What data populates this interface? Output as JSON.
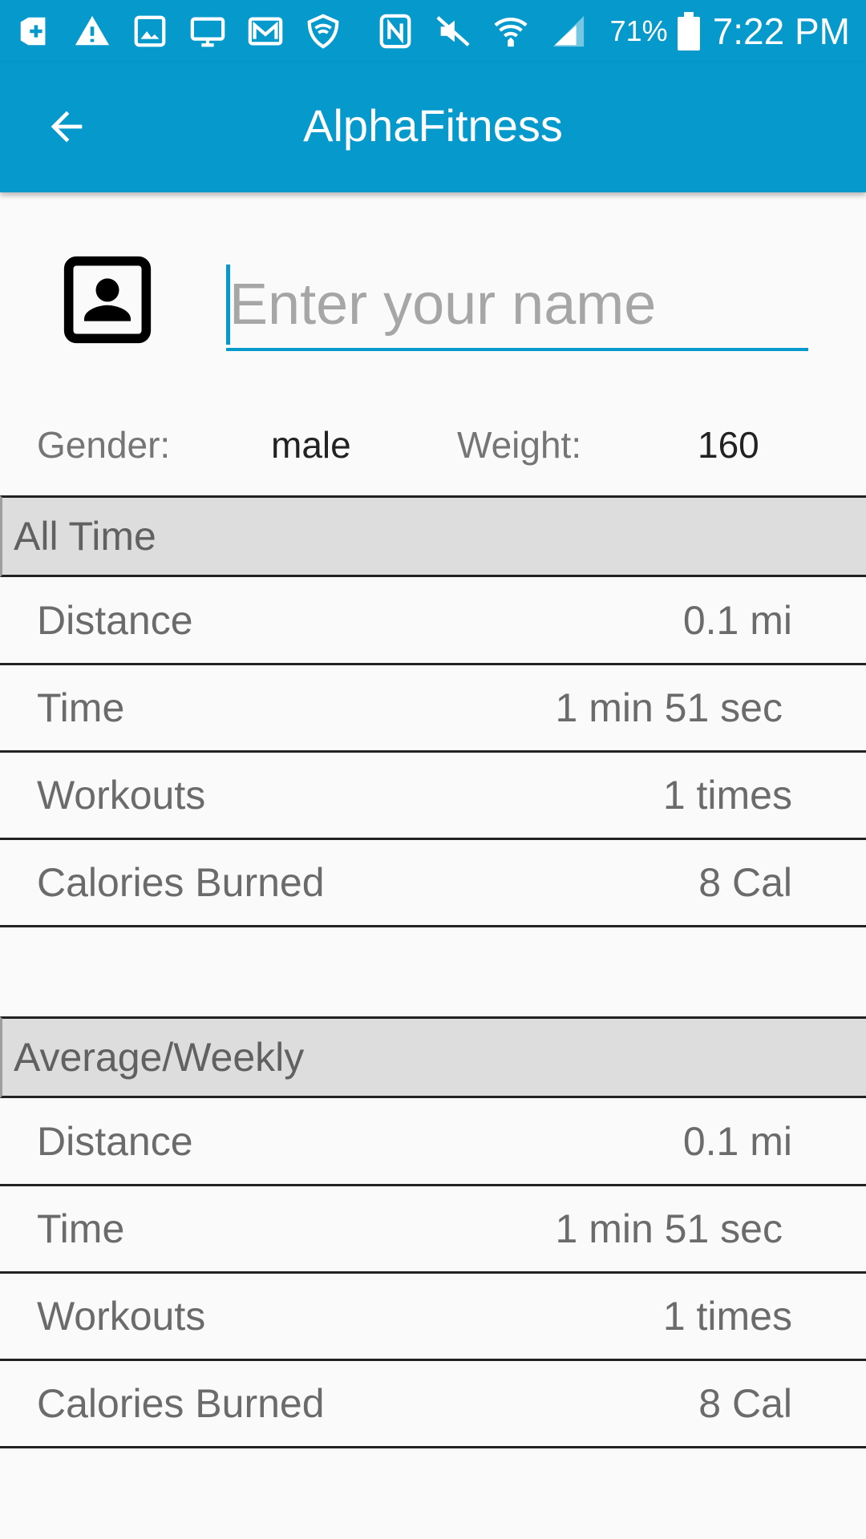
{
  "status_bar": {
    "icons": [
      "add-icon",
      "warning-icon",
      "image-icon",
      "monitor-icon",
      "mail-icon",
      "shield-icon",
      "nfc-icon",
      "mute-icon",
      "wifi-icon",
      "signal-icon",
      "battery-icon"
    ],
    "battery_percent": "71%",
    "time": "7:22 PM"
  },
  "app_bar": {
    "title": "AlphaFitness",
    "back_icon": "arrow-back-icon"
  },
  "profile": {
    "icon": "account-box-icon",
    "name_placeholder": "Enter your name",
    "name_value": ""
  },
  "info": {
    "gender_label": "Gender:",
    "gender_value": "male",
    "weight_label": "Weight:",
    "weight_value": "160"
  },
  "all_time": {
    "header": "All Time",
    "rows": [
      {
        "label": "Distance",
        "value": "0.1 mi"
      },
      {
        "label": "Time",
        "value": "1 min 51 sec"
      },
      {
        "label": "Workouts",
        "value": "1 times"
      },
      {
        "label": "Calories Burned",
        "value": "8 Cal"
      }
    ]
  },
  "average_weekly": {
    "header": "Average/Weekly",
    "rows": [
      {
        "label": "Distance",
        "value": "0.1 mi"
      },
      {
        "label": "Time",
        "value": "1 min 51 sec"
      },
      {
        "label": "Workouts",
        "value": "1 times"
      },
      {
        "label": "Calories Burned",
        "value": "8 Cal"
      }
    ]
  },
  "colors": {
    "primary": "#0599cc",
    "section_bg": "#dddddd",
    "text_secondary": "#757575"
  }
}
